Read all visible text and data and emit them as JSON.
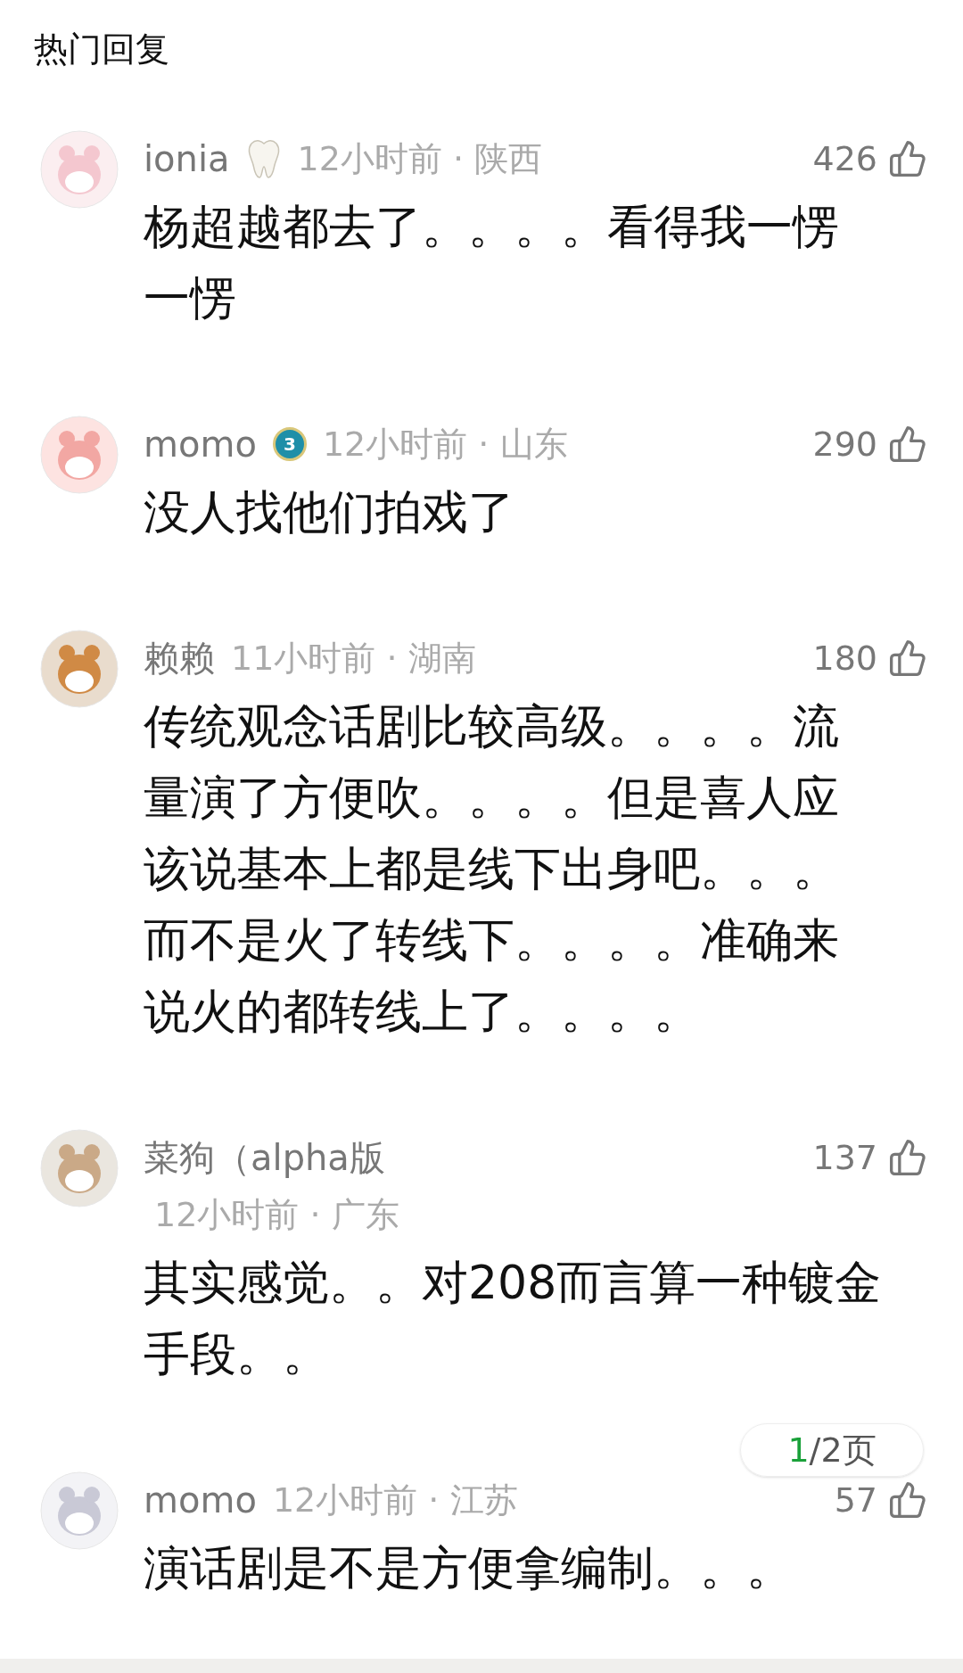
{
  "section_title": "热门回复",
  "separator": "·",
  "comments": [
    {
      "name": "ionia",
      "badge": {
        "kind": "tooth"
      },
      "time": "12小时前",
      "location": "陕西",
      "time_on_new_line": false,
      "likes": "426",
      "text": "杨超越都去了。。。。看得我一愣一愣"
    },
    {
      "name": "momo",
      "badge": {
        "kind": "level",
        "label": "3"
      },
      "time": "12小时前",
      "location": "山东",
      "time_on_new_line": false,
      "likes": "290",
      "text": "没人找他们拍戏了"
    },
    {
      "name": "赖赖",
      "time": "11小时前",
      "location": "湖南",
      "time_on_new_line": false,
      "likes": "180",
      "text": "传统观念话剧比较高级。。。。流量演了方便吹。。。。但是喜人应该说基本上都是线下出身吧。。。而不是火了转线下。。。。准确来说火的都转线上了。。。。"
    },
    {
      "name": "菜狗（alpha版",
      "time": "12小时前",
      "location": "广东",
      "time_on_new_line": true,
      "likes": "137",
      "text": "其实感觉。。对208而言算一种镀金手段。。"
    },
    {
      "name": "momo",
      "time": "12小时前",
      "location": "江苏",
      "time_on_new_line": false,
      "likes": "57",
      "text": "演话剧是不是方便拿编制。。。"
    }
  ],
  "pager": {
    "current": "1",
    "rest": "/2页"
  }
}
